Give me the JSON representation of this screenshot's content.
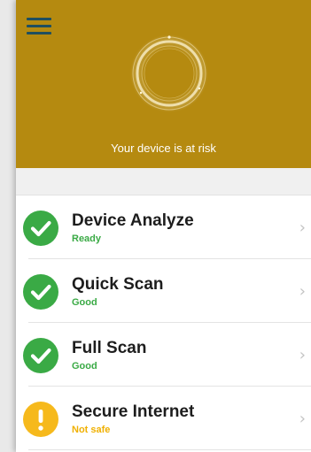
{
  "header": {
    "status_text": "Your device is at risk",
    "background_color": "#b58a10",
    "menu_icon": "hamburger-menu-icon",
    "indicator_icon": "risk-ring-icon"
  },
  "items": [
    {
      "title": "Device Analyze",
      "status": "Ready",
      "status_type": "ok",
      "icon": "check-circle-icon",
      "status_color": "#3aaa45",
      "icon_color": "#3aaa45"
    },
    {
      "title": "Quick Scan",
      "status": "Good",
      "status_type": "ok",
      "icon": "check-circle-icon",
      "status_color": "#3aaa45",
      "icon_color": "#3aaa45"
    },
    {
      "title": "Full Scan",
      "status": "Good",
      "status_type": "ok",
      "icon": "check-circle-icon",
      "status_color": "#3aaa45",
      "icon_color": "#3aaa45"
    },
    {
      "title": "Secure Internet",
      "status": "Not safe",
      "status_type": "warning",
      "icon": "exclamation-circle-icon",
      "status_color": "#f0b000",
      "icon_color": "#f6b91c"
    }
  ]
}
